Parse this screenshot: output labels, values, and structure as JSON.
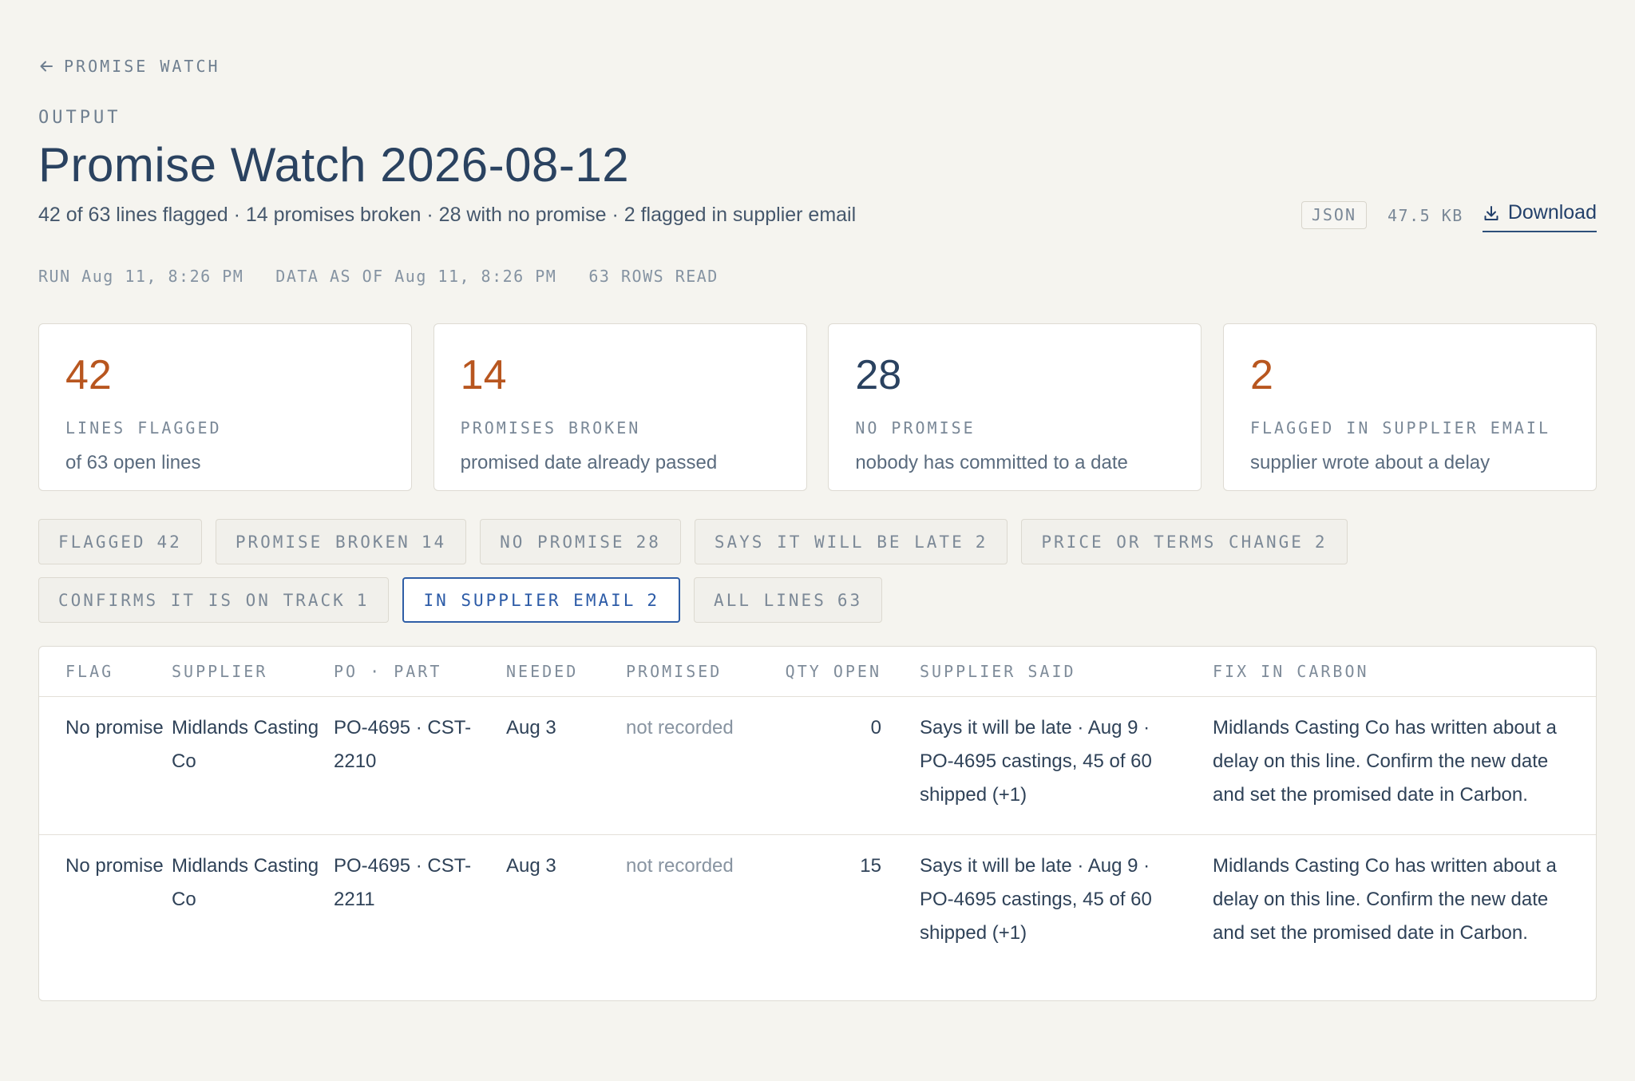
{
  "nav": {
    "back_label": "PROMISE WATCH"
  },
  "header": {
    "eyebrow": "OUTPUT",
    "title": "Promise Watch 2026-08-12",
    "summary": "42 of 63 lines flagged · 14 promises broken · 28 with no promise · 2 flagged in supplier email",
    "file_format": "JSON",
    "file_size": "47.5 KB",
    "download_label": "Download"
  },
  "run_meta": {
    "run": "RUN Aug 11, 8:26 PM",
    "data_as_of": "DATA AS OF Aug 11, 8:26 PM",
    "rows_read": "63 ROWS READ"
  },
  "stats": [
    {
      "value": "42",
      "label": "LINES FLAGGED",
      "sub": "of 63 open lines",
      "color": "#b8561f"
    },
    {
      "value": "14",
      "label": "PROMISES BROKEN",
      "sub": "promised date already passed",
      "color": "#b8561f"
    },
    {
      "value": "28",
      "label": "NO PROMISE",
      "sub": "nobody has committed to a date",
      "color": "#2a4260"
    },
    {
      "value": "2",
      "label": "FLAGGED IN SUPPLIER EMAIL",
      "sub": "supplier wrote about a delay",
      "color": "#b8561f"
    }
  ],
  "filters": [
    {
      "label": "FLAGGED",
      "count": "42",
      "active": false
    },
    {
      "label": "PROMISE BROKEN",
      "count": "14",
      "active": false
    },
    {
      "label": "NO PROMISE",
      "count": "28",
      "active": false
    },
    {
      "label": "SAYS IT WILL BE LATE",
      "count": "2",
      "active": false
    },
    {
      "label": "PRICE OR TERMS CHANGE",
      "count": "2",
      "active": false
    },
    {
      "label": "CONFIRMS IT IS ON TRACK",
      "count": "1",
      "active": false
    },
    {
      "label": "IN SUPPLIER EMAIL",
      "count": "2",
      "active": true
    },
    {
      "label": "ALL LINES",
      "count": "63",
      "active": false
    }
  ],
  "table": {
    "columns": [
      "FLAG",
      "SUPPLIER",
      "PO · PART",
      "NEEDED",
      "PROMISED",
      "QTY OPEN",
      "SUPPLIER SAID",
      "FIX IN CARBON"
    ],
    "rows": [
      {
        "flag": "No promise",
        "supplier": "Midlands Casting Co",
        "po_part": "PO-4695 · CST-2210",
        "needed": "Aug 3",
        "promised": "not recorded",
        "qty_open": "0",
        "supplier_said": "Says it will be late · Aug 9 · PO-4695 castings, 45 of 60 shipped (+1)",
        "fix": "Midlands Casting Co has written about a delay on this line. Confirm the new date and set the promised date in Carbon."
      },
      {
        "flag": "No promise",
        "supplier": "Midlands Casting Co",
        "po_part": "PO-4695 · CST-2211",
        "needed": "Aug 3",
        "promised": "not recorded",
        "qty_open": "15",
        "supplier_said": "Says it will be late · Aug 9 · PO-4695 castings, 45 of 60 shipped (+1)",
        "fix": "Midlands Casting Co has written about a delay on this line. Confirm the new date and set the promised date in Carbon."
      }
    ]
  }
}
